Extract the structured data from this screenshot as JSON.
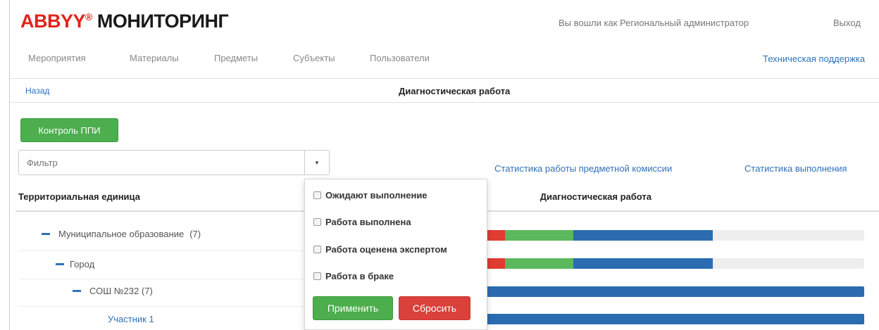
{
  "header": {
    "logo_brand": "ABBYY",
    "logo_mark": "®",
    "logo_product": "МОНИТОРИНГ",
    "logged_in_text": "Вы вошли как Региональный администратор",
    "logout_label": "Выход"
  },
  "nav": {
    "items": [
      {
        "label": "Мероприятия"
      },
      {
        "label": "Материалы"
      },
      {
        "label": "Предметы"
      },
      {
        "label": "Субъекты"
      },
      {
        "label": "Пользователи"
      }
    ],
    "support_label": "Техническая поддержка"
  },
  "page": {
    "back_label": "Назад",
    "title": "Диагностическая работа"
  },
  "toolbar": {
    "control_button_label": "Контроль ППИ"
  },
  "filter": {
    "placeholder": "Фильтр",
    "toggle_icon": "caret-down-icon"
  },
  "stats_links": [
    {
      "label": "Статистика работы предметной комиссии"
    },
    {
      "label": "Статистика выполнения"
    }
  ],
  "table": {
    "columns": {
      "unit": "Территориальная единица",
      "work": "Диагностическая работа"
    },
    "rows": [
      {
        "name": "Муниципальное образование",
        "count": "(7)"
      },
      {
        "name": "Город",
        "count": ""
      },
      {
        "name": "СОШ №232 (7)",
        "count": ""
      },
      {
        "name": "Участник 1",
        "count": ""
      }
    ]
  },
  "progress": {
    "colors": {
      "red": "#e03c31",
      "green": "#5cb85c",
      "blue": "#2b6cb0",
      "track": "#eeeeee"
    },
    "rows": [
      {
        "red": 0.05,
        "green": 0.18,
        "blue": 0.37
      },
      {
        "red": 0.05,
        "green": 0.18,
        "blue": 0.37
      },
      {
        "red": 0.0,
        "green": 0.0,
        "blue": 1.0
      },
      {
        "red": 0.0,
        "green": 0.0,
        "blue": 1.0
      }
    ]
  },
  "dropdown": {
    "options": [
      {
        "label": "Ожидают выполнение",
        "checked": false
      },
      {
        "label": "Работа выполнена",
        "checked": false
      },
      {
        "label": "Работа оценена экспертом",
        "checked": false
      },
      {
        "label": "Работа в браке",
        "checked": false
      }
    ],
    "apply_label": "Применить",
    "reset_label": "Сбросить"
  }
}
